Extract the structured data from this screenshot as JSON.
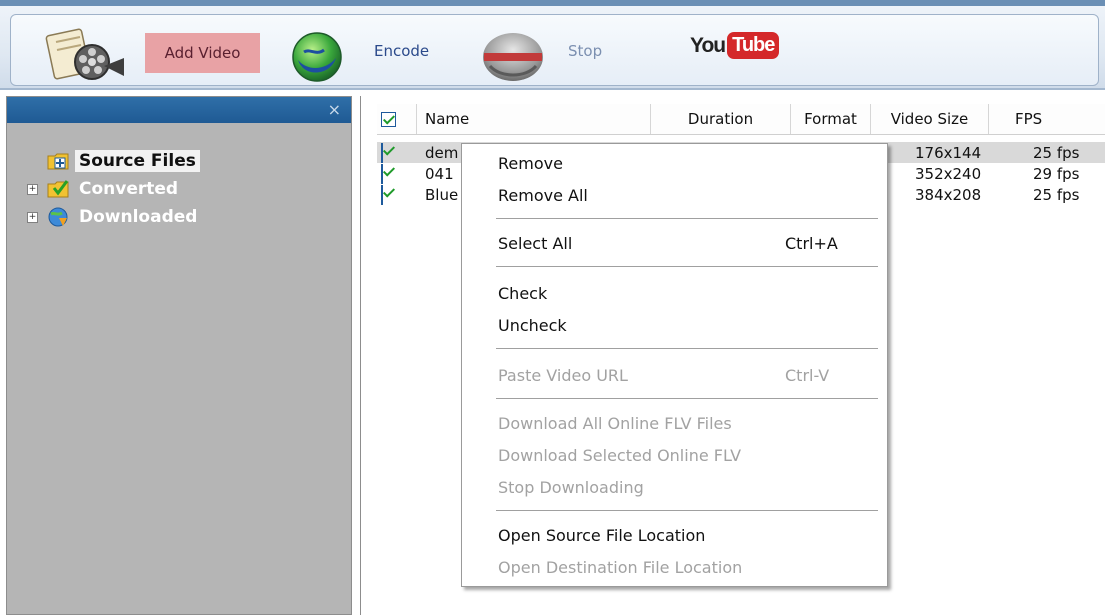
{
  "toolbar": {
    "add_video_label": "Add Video",
    "encode_label": "Encode",
    "stop_label": "Stop",
    "youtube_you": "You",
    "youtube_tube": "Tube"
  },
  "left_panel": {
    "close_glyph": "×",
    "tree": [
      {
        "label": "Source Files",
        "icon": "folder-add-icon",
        "selected": true
      },
      {
        "label": "Converted",
        "icon": "folder-check-icon",
        "expander": "+"
      },
      {
        "label": "Downloaded",
        "icon": "globe-download-icon",
        "expander": "+"
      }
    ]
  },
  "list": {
    "columns": {
      "name": "Name",
      "duration": "Duration",
      "format": "Format",
      "video_size": "Video Size",
      "fps": "FPS"
    },
    "rows": [
      {
        "name": "dem",
        "video_size": "176x144",
        "fps": "25 fps"
      },
      {
        "name": "041",
        "video_size": "352x240",
        "fps": "29 fps"
      },
      {
        "name": "Blue",
        "video_size": "384x208",
        "fps": "25 fps"
      }
    ]
  },
  "context_menu": {
    "remove": "Remove",
    "remove_all": "Remove All",
    "select_all": "Select All",
    "select_all_shortcut": "Ctrl+A",
    "check": "Check",
    "uncheck": "Uncheck",
    "paste_url": "Paste Video URL",
    "paste_url_shortcut": "Ctrl-V",
    "download_all": "Download All Online FLV Files",
    "download_selected": "Download Selected Online FLV",
    "stop_downloading": "Stop Downloading",
    "open_source": "Open Source File Location",
    "open_destination": "Open Destination File Location"
  },
  "colors": {
    "accent": "#1f5a94",
    "add_video_highlight": "#e8a2a5",
    "youtube_red": "#d4282a",
    "disabled_text": "#a2a2a2"
  }
}
